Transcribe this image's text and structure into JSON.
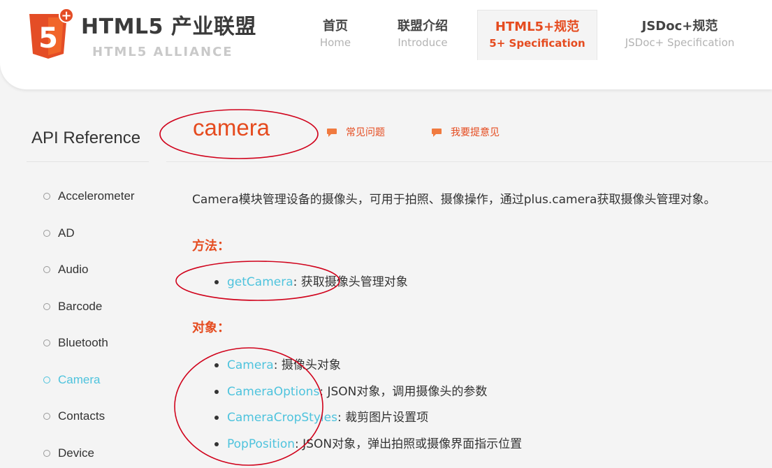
{
  "brand": {
    "logo_number": "5",
    "title": "HTML5 产业联盟",
    "subtitle": "HTML5 ALLIANCE"
  },
  "nav": [
    {
      "zh": "首页",
      "en": "Home"
    },
    {
      "zh": "联盟介绍",
      "en": "Introduce"
    },
    {
      "zh": "HTML5+规范",
      "en": "5+ Specification",
      "active": true
    },
    {
      "zh": "JSDoc+规范",
      "en": "JSDoc+ Specification"
    }
  ],
  "sidebar": {
    "title": "API Reference",
    "items": [
      {
        "label": "Accelerometer"
      },
      {
        "label": "AD"
      },
      {
        "label": "Audio"
      },
      {
        "label": "Barcode"
      },
      {
        "label": "Bluetooth"
      },
      {
        "label": "Camera",
        "active": true
      },
      {
        "label": "Contacts"
      },
      {
        "label": "Device"
      }
    ]
  },
  "content": {
    "title": "camera",
    "faq_link": "常见问题",
    "feedback_link": "我要提意见",
    "intro": "Camera模块管理设备的摄像头，可用于拍照、摄像操作，通过plus.camera获取摄像头管理对象。",
    "methods_heading": "方法：",
    "methods": [
      {
        "name": "getCamera",
        "desc": ": 获取摄像头管理对象"
      }
    ],
    "objects_heading": "对象：",
    "objects": [
      {
        "name": "Camera",
        "desc": ": 摄像头对象"
      },
      {
        "name": "CameraOptions",
        "desc": ": JSON对象，调用摄像头的参数"
      },
      {
        "name": "CameraCropStyles",
        "desc": ": 裁剪图片设置项"
      },
      {
        "name": "PopPosition",
        "desc": ": JSON对象，弹出拍照或摄像界面指示位置"
      }
    ]
  },
  "colors": {
    "accent": "#e54b1f",
    "link": "#4ec3dd",
    "annotation": "#d0021b"
  },
  "icons": {
    "logo": "html5-shield-icon",
    "logo_badge": "plus-badge-icon",
    "faq": "speech-bubble-icon",
    "feedback": "speech-bubble-icon",
    "sidebar_bullet": "hollow-circle-icon",
    "list_bullet": "filled-dot-icon"
  }
}
